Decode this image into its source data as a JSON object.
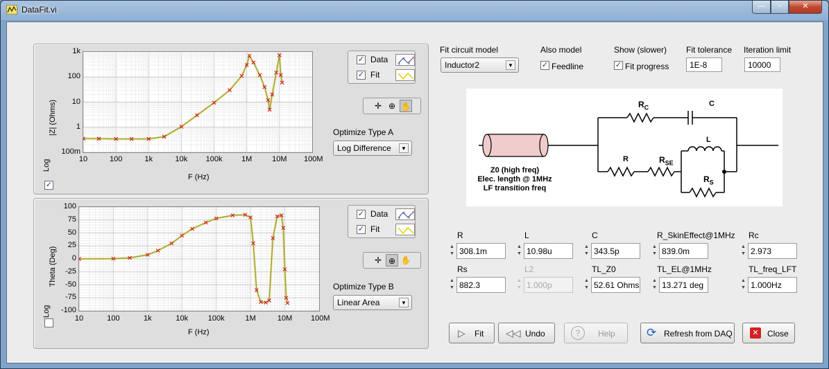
{
  "window": {
    "title": "DataFit.vi",
    "min_label": "—",
    "max_label": "▫",
    "close_label": "✕"
  },
  "plot_mag": {
    "ylabel": "|Z| (Ohms)",
    "xlabel": "F (Hz)",
    "y_ticks": [
      "1k",
      "100",
      "10",
      "1",
      "100m"
    ],
    "x_ticks": [
      "10",
      "100",
      "1k",
      "10k",
      "100k",
      "1M",
      "10M",
      "100M"
    ],
    "log_label": "Log",
    "log_checked": true,
    "legend": {
      "data_label": "Data",
      "fit_label": "Fit",
      "data_checked": true,
      "fit_checked": true
    },
    "optimize_label": "Optimize Type A",
    "optimize_value": "Log Difference"
  },
  "plot_phase": {
    "ylabel": "Theta (Deg)",
    "xlabel": "F (Hz)",
    "y_ticks": [
      "100",
      "75",
      "50",
      "25",
      "0",
      "-25",
      "-50",
      "-75",
      "-100"
    ],
    "x_ticks": [
      "10",
      "100",
      "1k",
      "10k",
      "100k",
      "1M",
      "10M",
      "100M"
    ],
    "log_label": "Log",
    "log_checked": false,
    "legend": {
      "data_label": "Data",
      "fit_label": "Fit",
      "data_checked": true,
      "fit_checked": true
    },
    "optimize_label": "Optimize Type B",
    "optimize_value": "Linear Area"
  },
  "chart_data": [
    {
      "type": "scatter",
      "xlabel": "F (Hz)",
      "ylabel": "|Z| (Ohms)",
      "x_scale": "log",
      "y_scale": "log",
      "xlim": [
        10,
        100000000
      ],
      "ylim": [
        0.1,
        1000
      ],
      "x_ticks": [
        "10",
        "100",
        "1k",
        "10k",
        "100k",
        "1M",
        "10M",
        "100M"
      ],
      "y_ticks": [
        "100m",
        "1",
        "10",
        "100",
        "1k"
      ],
      "grid": true,
      "series": [
        {
          "name": "Data",
          "marker": "x",
          "color": "#d42020",
          "x": [
            10,
            30,
            100,
            300,
            1000,
            3000,
            10000,
            30000,
            100000,
            300000,
            700000,
            1000000,
            1200000,
            1600000,
            2500000,
            3500000,
            4500000,
            5000000,
            6000000,
            8000000,
            10000000,
            11000000,
            12000000
          ],
          "y": [
            0.35,
            0.35,
            0.34,
            0.34,
            0.34,
            0.42,
            1.05,
            3.0,
            9.5,
            30,
            110,
            300,
            700,
            380,
            120,
            40,
            12,
            5,
            20,
            150,
            750,
            120,
            60
          ]
        },
        {
          "name": "Fit",
          "marker": "line",
          "color": "#e6d000",
          "x": [
            10,
            30,
            100,
            300,
            1000,
            3000,
            10000,
            30000,
            100000,
            300000,
            700000,
            1000000,
            1200000,
            1600000,
            2500000,
            3500000,
            4500000,
            5000000,
            6000000,
            8000000,
            10000000,
            11000000,
            12000000
          ],
          "y": [
            0.35,
            0.35,
            0.34,
            0.34,
            0.34,
            0.42,
            1.05,
            3.0,
            9.5,
            30,
            110,
            300,
            700,
            380,
            120,
            40,
            12,
            5,
            20,
            150,
            750,
            120,
            60
          ]
        }
      ]
    },
    {
      "type": "scatter",
      "xlabel": "F (Hz)",
      "ylabel": "Theta (Deg)",
      "x_scale": "log",
      "y_scale": "linear",
      "xlim": [
        10,
        100000000
      ],
      "ylim": [
        -100,
        100
      ],
      "x_ticks": [
        "10",
        "100",
        "1k",
        "10k",
        "100k",
        "1M",
        "10M",
        "100M"
      ],
      "y_ticks": [
        "-100",
        "-75",
        "-50",
        "-25",
        "0",
        "25",
        "50",
        "75",
        "100"
      ],
      "grid": true,
      "series": [
        {
          "name": "Data",
          "marker": "x",
          "color": "#d42020",
          "x": [
            10,
            100,
            300,
            1000,
            2000,
            5000,
            10000,
            20000,
            50000,
            100000,
            300000,
            700000,
            1000000,
            1200000,
            1500000,
            2000000,
            2800000,
            3500000,
            4500000,
            6000000,
            8000000,
            9000000,
            10000000,
            11000000,
            12000000
          ],
          "y": [
            0,
            0.5,
            2,
            8,
            16,
            30,
            45,
            58,
            70,
            78,
            84,
            85,
            80,
            30,
            -60,
            -83,
            -84,
            -80,
            40,
            82,
            84,
            60,
            -20,
            -75,
            -85
          ]
        },
        {
          "name": "Fit",
          "marker": "line",
          "color": "#e6d000",
          "x": [
            10,
            100,
            300,
            1000,
            2000,
            5000,
            10000,
            20000,
            50000,
            100000,
            300000,
            700000,
            1000000,
            1200000,
            1500000,
            2000000,
            2800000,
            3500000,
            4500000,
            6000000,
            8000000,
            9000000,
            10000000,
            11000000,
            12000000
          ],
          "y": [
            0,
            0.5,
            2,
            8,
            16,
            30,
            45,
            58,
            70,
            78,
            84,
            85,
            80,
            30,
            -60,
            -83,
            -84,
            -80,
            40,
            82,
            84,
            60,
            -20,
            -75,
            -85
          ]
        }
      ]
    }
  ],
  "settings": {
    "circuit_label": "Fit circuit model",
    "circuit_value": "Inductor2",
    "also_model_label": "Also model",
    "feedline_label": "Feedline",
    "feedline_checked": true,
    "show_label": "Show (slower)",
    "progress_label": "Fit progress",
    "progress_checked": true,
    "tolerance_label": "Fit tolerance",
    "tolerance_value": "1E-8",
    "iter_label": "Iteration limit",
    "iter_value": "10000"
  },
  "schematic": {
    "rc_main": "R",
    "rc_sub": "C",
    "c": "C",
    "l": "L",
    "r": "R",
    "rse_main": "R",
    "rse_sub": "SE",
    "rs_main": "R",
    "rs_sub": "S",
    "tl_line1": "Z0 (high freq)",
    "tl_line2": "Elec. length @ 1MHz",
    "tl_line3": "LF transition freq"
  },
  "params": [
    {
      "label": "R",
      "value": "308.1m",
      "disabled": false
    },
    {
      "label": "L",
      "value": "10.98u",
      "disabled": false
    },
    {
      "label": "C",
      "value": "343.5p",
      "disabled": false
    },
    {
      "label": "R_SkinEffect@1MHz",
      "value": "839.0m",
      "disabled": false
    },
    {
      "label": "Rc",
      "value": "2.973",
      "disabled": false
    },
    {
      "label": "Rs",
      "value": "882.3",
      "disabled": false
    },
    {
      "label": "L2",
      "value": "1.000p",
      "disabled": true
    },
    {
      "label": "TL_Z0",
      "value": "52.61 Ohms",
      "disabled": false
    },
    {
      "label": "TL_EL@1MHz",
      "value": "13.271 deg",
      "disabled": false
    },
    {
      "label": "TL_freq_LFT",
      "value": "1.000Hz",
      "disabled": false
    }
  ],
  "buttons": {
    "fit": "Fit",
    "undo": "Undo",
    "help": "Help",
    "refresh": "Refresh from DAQ",
    "close": "Close"
  },
  "icons": {
    "spin": "spin-arrows-icon",
    "combo": "dropdown-arrow-icon"
  }
}
